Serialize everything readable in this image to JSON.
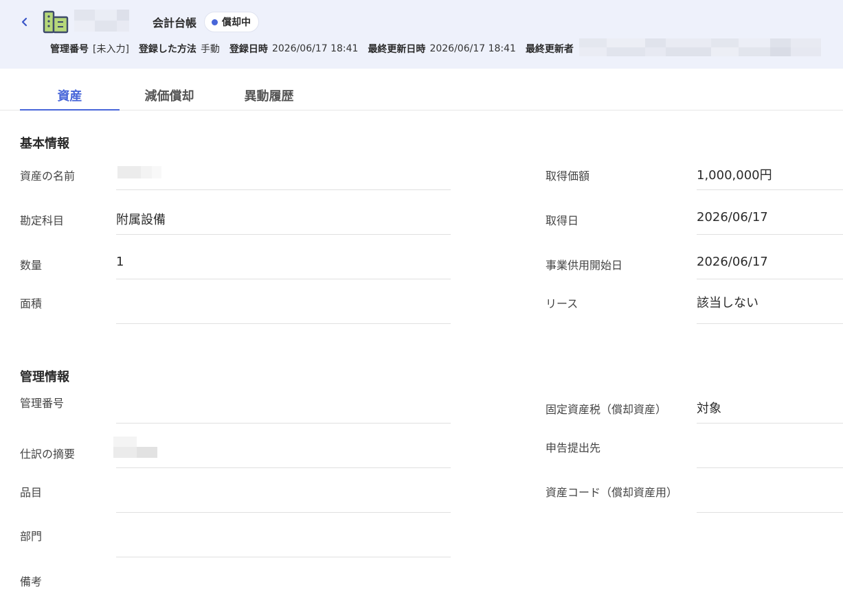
{
  "header": {
    "back_icon": "chevron-left-icon",
    "asset_icon": "building-icon",
    "ledger_label": "会計台帳",
    "status": {
      "label": "償却中",
      "dot_color": "#4866d9"
    },
    "meta": [
      {
        "key": "管理番号",
        "value": "[未入力]"
      },
      {
        "key": "登録した方法",
        "value": "手動"
      },
      {
        "key": "登録日時",
        "value": "2026/06/17 18:41"
      },
      {
        "key": "最終更新日時",
        "value": "2026/06/17 18:41"
      },
      {
        "key": "最終更新者",
        "value": ""
      }
    ]
  },
  "tabs": [
    {
      "label": "資産",
      "active": true
    },
    {
      "label": "減価償却",
      "active": false
    },
    {
      "label": "異動履歴",
      "active": false
    }
  ],
  "basic_info": {
    "title": "基本情報",
    "left": [
      {
        "label": "資産の名前",
        "value": ""
      },
      {
        "label": "勘定科目",
        "value": "附属設備"
      },
      {
        "label": "数量",
        "value": "1"
      },
      {
        "label": "面積",
        "value": ""
      }
    ],
    "right": [
      {
        "label": "取得価額",
        "value": "1,000,000円"
      },
      {
        "label": "取得日",
        "value": "2026/06/17"
      },
      {
        "label": "事業供用開始日",
        "value": "2026/06/17"
      },
      {
        "label": "リース",
        "value": "該当しない"
      }
    ]
  },
  "management_info": {
    "title": "管理情報",
    "left": [
      {
        "label": "管理番号",
        "value": ""
      },
      {
        "label": "仕訳の摘要",
        "value": ""
      },
      {
        "label": "品目",
        "value": ""
      },
      {
        "label": "部門",
        "value": ""
      },
      {
        "label": "備考",
        "value": ""
      }
    ],
    "right": [
      {
        "label": "固定資産税（償却資産）",
        "value": "対象"
      },
      {
        "label": "申告提出先",
        "value": ""
      },
      {
        "label": "資産コード（償却資産用）",
        "value": ""
      }
    ]
  },
  "colors": {
    "accent": "#4866d9",
    "header_bg": "#eef1fb",
    "icon_fill": "#b6d87a",
    "icon_stroke": "#3d4a6b"
  }
}
